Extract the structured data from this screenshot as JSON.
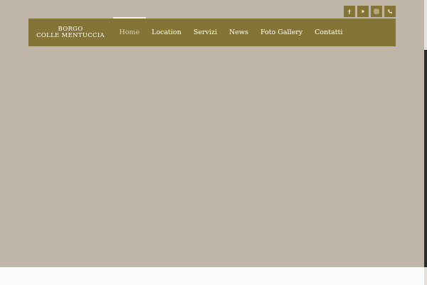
{
  "logo": {
    "line1": "BORGO",
    "line2": "COLLE MENTUCCIA"
  },
  "nav": {
    "items": [
      {
        "label": "Home",
        "active": true
      },
      {
        "label": "Location"
      },
      {
        "label": "Servizi"
      },
      {
        "label": "News"
      },
      {
        "label": "Foto Gallery"
      },
      {
        "label": "Contatti"
      }
    ]
  },
  "social": {
    "icons": [
      "facebook-icon",
      "youtube-icon",
      "instagram-icon",
      "phone-icon"
    ]
  },
  "colors": {
    "accent": "#847536",
    "hero_bg": "#c0b6a8",
    "footer_bg": "#fbfbfa"
  }
}
